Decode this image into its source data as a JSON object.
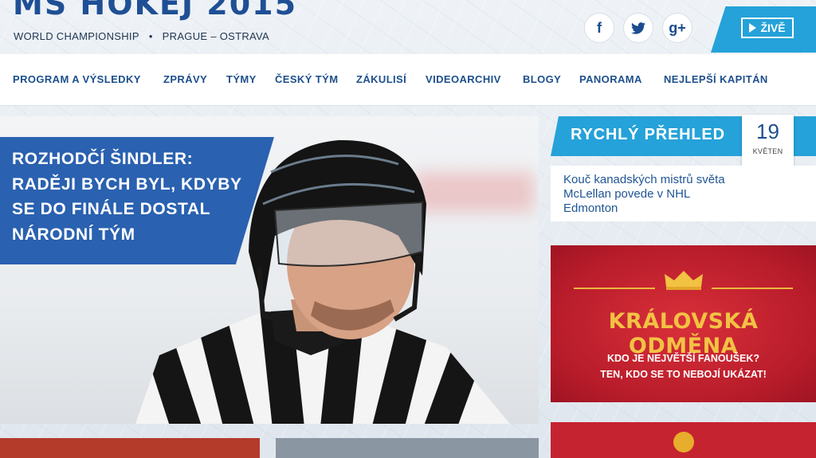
{
  "header": {
    "logo_title": "MS HOKEJ 2015",
    "logo_sub_left": "WORLD CHAMPIONSHIP",
    "logo_sub_dot": "•",
    "logo_sub_right": "PRAGUE – OSTRAVA",
    "social": [
      {
        "icon": "facebook-icon",
        "glyph": "f"
      },
      {
        "icon": "twitter-icon",
        "glyph": "t"
      },
      {
        "icon": "google-plus-icon",
        "glyph": "g+"
      }
    ],
    "live_label": "ŽIVĚ"
  },
  "nav": {
    "items": [
      {
        "label": "PROGRAM A VÝSLEDKY"
      },
      {
        "label": "ZPRÁVY"
      },
      {
        "label": "TÝMY"
      },
      {
        "label": "ČESKÝ TÝM"
      },
      {
        "label": "ZÁKULISÍ"
      },
      {
        "label": "VIDEOARCHIV"
      },
      {
        "label": "BLOGY"
      },
      {
        "label": "PANORAMA"
      },
      {
        "label": "NEJLEPŠÍ KAPITÁN"
      }
    ]
  },
  "hero": {
    "headline": "ROZHODČÍ ŠINDLER: RADĚJI BYCH BYL, KDYBY SE DO FINÁLE DOSTAL NÁRODNÍ TÝM"
  },
  "quick": {
    "title": "RYCHLÝ PŘEHLED",
    "date_day": "19",
    "date_month": "KVĚTEN",
    "news": "Kouč kanadských mistrů světa McLellan povede v NHL Edmonton"
  },
  "ad": {
    "title": "KRÁLOVSKÁ ODMĚNA",
    "line1": "KDO JE NEJVĚTŠÍ FANOUŠEK?",
    "line2": "TEN, KDO SE TO NEBOJÍ UKÁZAT!"
  },
  "colors": {
    "brand_blue": "#1d4f8c",
    "accent_cyan": "#25a2d9",
    "headline_bg": "#2a61b0",
    "ad_red": "#c62330",
    "ad_gold": "#f2c243"
  }
}
